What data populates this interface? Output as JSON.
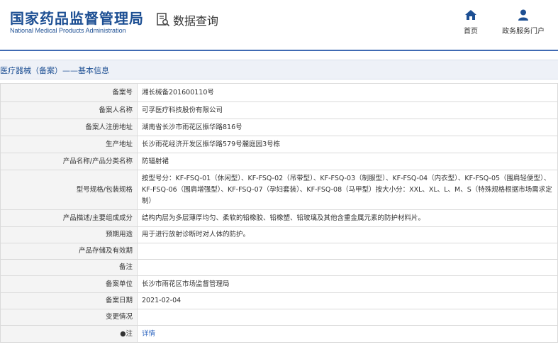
{
  "header": {
    "logo_cn": "国家药品监督管理局",
    "logo_en": "National Medical Products Administration",
    "section_title": "数据查询",
    "nav": {
      "home": "首页",
      "gov": "政务服务门户"
    }
  },
  "breadcrumb": "医疗器械（备案）——基本信息",
  "rows": [
    {
      "key": "备案号",
      "value": "湘长械备201600110号"
    },
    {
      "key": "备案人名称",
      "value": "可孚医疗科技股份有限公司"
    },
    {
      "key": "备案人注册地址",
      "value": "湖南省长沙市雨花区振华路816号"
    },
    {
      "key": "生产地址",
      "value": "长沙雨花经济开发区振华路579号麓庭园3号栋"
    },
    {
      "key": "产品名称/产品分类名称",
      "value": "防辐射裙"
    },
    {
      "key": "型号规格/包装规格",
      "value": "按型号分：KF-FSQ-01（休闲型）、KF-FSQ-02（吊带型）、KF-FSQ-03（制服型）、KF-FSQ-04（内衣型）、KF-FSQ-05（围肩轻便型）、KF-FSQ-06（围肩增强型）、KF-FSQ-07（孕妇套装）、KF-FSQ-08（马甲型）按大小分：XXL、XL、L、M、S（特殊规格根据市场需求定制）"
    },
    {
      "key": "产品描述/主要组成成分",
      "value": "结构内层为多层薄厚均匀、柔软的铅橡胶、铅橡塑、铅玻璃及其他含重金属元素的防护材料片。"
    },
    {
      "key": "预期用途",
      "value": "用于进行放射诊断时对人体的防护。"
    },
    {
      "key": "产品存储及有效期",
      "value": ""
    },
    {
      "key": "备注",
      "value": ""
    },
    {
      "key": "备案单位",
      "value": "长沙市雨花区市场监督管理局"
    },
    {
      "key": "备案日期",
      "value": "2021-02-04"
    },
    {
      "key": "变更情况",
      "value": ""
    }
  ],
  "note_row": {
    "key": "●注",
    "link": "详情"
  },
  "colors": {
    "brand_blue": "#1d4f93",
    "link_blue": "#3067c0",
    "label_bg": "#f4f4f4"
  },
  "icons": [
    "data-query-icon",
    "home-icon",
    "user-icon"
  ]
}
